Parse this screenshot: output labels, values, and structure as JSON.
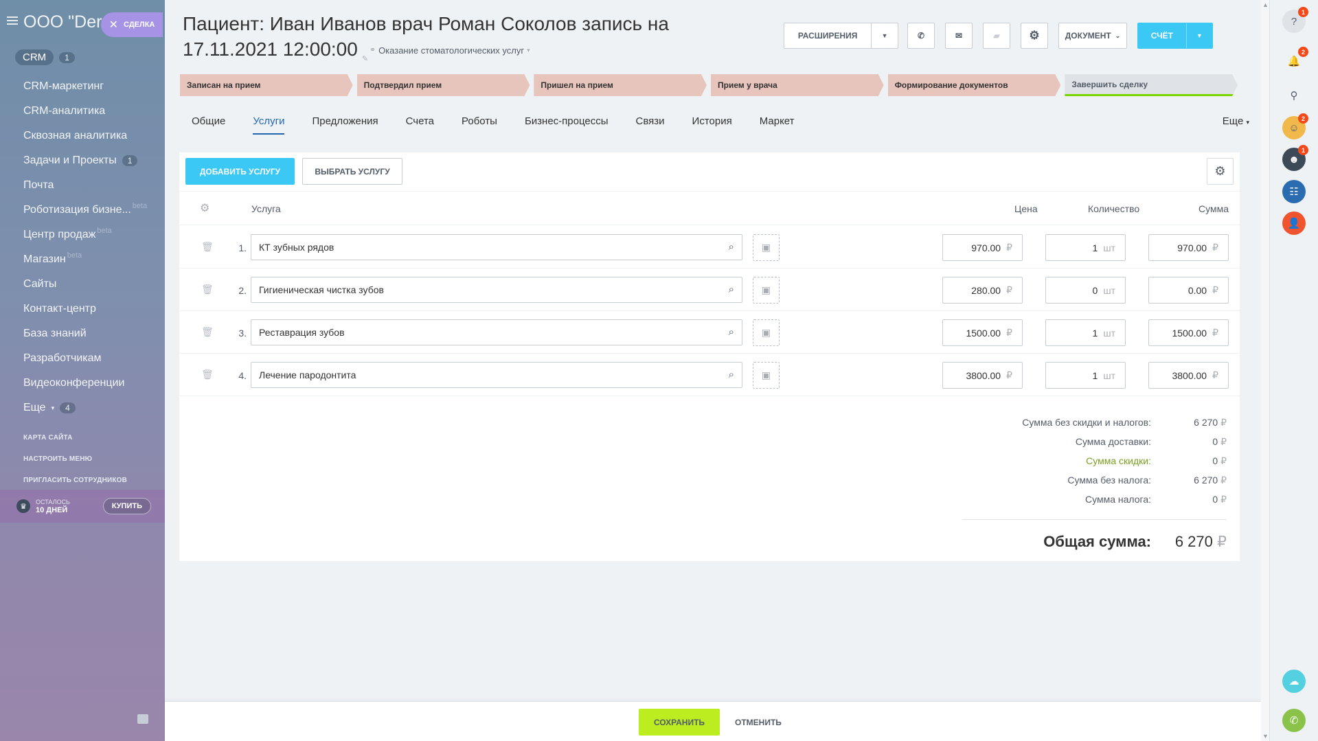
{
  "sidebar": {
    "company": "ООО \"Der",
    "crm_label": "CRM",
    "crm_count": "1",
    "items": [
      {
        "label": "CRM-маркетинг"
      },
      {
        "label": "CRM-аналитика"
      },
      {
        "label": "Сквозная аналитика"
      },
      {
        "label": "Задачи и Проекты",
        "count": "1"
      },
      {
        "label": "Почта"
      },
      {
        "label": "Роботизация бизне...",
        "beta": "beta"
      },
      {
        "label": "Центр продаж",
        "beta": "beta"
      },
      {
        "label": "Магазин",
        "beta": "beta"
      },
      {
        "label": "Сайты"
      },
      {
        "label": "Контакт-центр"
      },
      {
        "label": "База знаний"
      },
      {
        "label": "Разработчикам"
      },
      {
        "label": "Видеоконференции"
      },
      {
        "label": "Еще",
        "count": "4"
      }
    ],
    "sitemap": "КАРТА САЙТА",
    "config_menu": "НАСТРОИТЬ МЕНЮ",
    "invite": "ПРИГЛАСИТЬ СОТРУДНИКОВ",
    "trial_left": "ОСТАЛОСЬ",
    "trial_days": "10 ДНЕЙ",
    "buy": "КУПИТЬ"
  },
  "deal_tab": {
    "label": "СДЕЛКА",
    "close": "✕"
  },
  "header": {
    "title": "Пациент: Иван Иванов врач Роман Соколов запись на 17.11.2021 12:00:00",
    "category": "Оказание стоматологических услуг"
  },
  "toolbar": {
    "extensions": "РАСШИРЕНИЯ",
    "document": "ДОКУМЕНТ",
    "invoice": "СЧЁТ"
  },
  "stages": [
    {
      "label": "Записан на прием"
    },
    {
      "label": "Подтвердил прием"
    },
    {
      "label": "Пришел на прием"
    },
    {
      "label": "Прием у врача"
    },
    {
      "label": "Формирование документов"
    },
    {
      "label": "Завершить сделку"
    }
  ],
  "tabs": [
    {
      "label": "Общие"
    },
    {
      "label": "Услуги"
    },
    {
      "label": "Предложения"
    },
    {
      "label": "Счета"
    },
    {
      "label": "Роботы"
    },
    {
      "label": "Бизнес-процессы"
    },
    {
      "label": "Связи"
    },
    {
      "label": "История"
    },
    {
      "label": "Маркет"
    }
  ],
  "tabs_more": "Еще",
  "products": {
    "add_button": "ДОБАВИТЬ УСЛУГУ",
    "select_button": "ВЫБРАТЬ УСЛУГУ",
    "columns": {
      "service": "Услуга",
      "price": "Цена",
      "quantity": "Количество",
      "sum": "Сумма"
    },
    "currency": "₽",
    "unit": "шт",
    "rows": [
      {
        "num": "1.",
        "name": "КТ зубных рядов",
        "price": "970.00",
        "qty": "1",
        "sum": "970.00"
      },
      {
        "num": "2.",
        "name": "Гигиеническая чистка зубов",
        "price": "280.00",
        "qty": "0",
        "sum": "0.00"
      },
      {
        "num": "3.",
        "name": "Реставрация зубов",
        "price": "1500.00",
        "qty": "1",
        "sum": "1500.00"
      },
      {
        "num": "4.",
        "name": "Лечение пародонтита",
        "price": "3800.00",
        "qty": "1",
        "sum": "3800.00"
      }
    ]
  },
  "totals": {
    "lines": [
      {
        "label": "Сумма без скидки и налогов:",
        "value": "6 270"
      },
      {
        "label": "Сумма доставки:",
        "value": "0"
      },
      {
        "label": "Сумма скидки:",
        "value": "0"
      },
      {
        "label": "Сумма без налога:",
        "value": "6 270"
      },
      {
        "label": "Сумма налога:",
        "value": "0"
      }
    ],
    "total_label": "Общая сумма:",
    "total_value": "6 270"
  },
  "footer": {
    "save": "СОХРАНИТЬ",
    "cancel": "ОТМЕНИТЬ"
  },
  "rightbar": {
    "help_badge": "1",
    "notif_badge": "2",
    "user1_badge": "2",
    "user2_badge": "1"
  },
  "colors": {
    "accent": "#3bc8f5",
    "save": "#bbed21",
    "stage": "#e7c5bc",
    "badge": "#f54819"
  }
}
